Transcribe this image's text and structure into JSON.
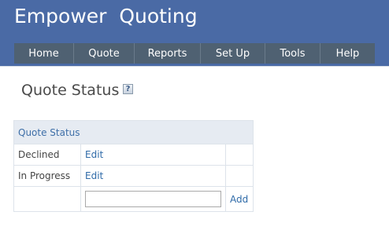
{
  "header": {
    "app_title": "Empower  Quoting",
    "background_color": "#4a6aa5",
    "nav_background_color": "#4f6172"
  },
  "nav": {
    "items": [
      {
        "label": "Home"
      },
      {
        "label": "Quote"
      },
      {
        "label": "Reports"
      },
      {
        "label": "Set Up"
      },
      {
        "label": "Tools"
      },
      {
        "label": "Help"
      }
    ]
  },
  "page": {
    "title": "Quote Status",
    "help_icon": "help-question-icon",
    "help_glyph": "?"
  },
  "table": {
    "header": "Quote Status",
    "rows": [
      {
        "status": "Declined",
        "action": "Edit"
      },
      {
        "status": "In Progress",
        "action": "Edit"
      }
    ],
    "new_row": {
      "input_value": "",
      "add_label": "Add"
    },
    "link_color": "#2e6aa8"
  }
}
